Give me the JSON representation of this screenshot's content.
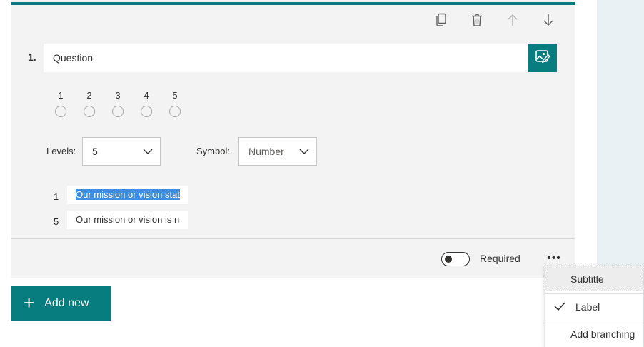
{
  "question": {
    "number": "1.",
    "title": "Question"
  },
  "rating": {
    "options": [
      "1",
      "2",
      "3",
      "4",
      "5"
    ]
  },
  "levels": {
    "label": "Levels:",
    "value": "5"
  },
  "symbol": {
    "label": "Symbol:",
    "value": "Number"
  },
  "level_labels": [
    {
      "num": "1",
      "text": "Our mission or vision stat"
    },
    {
      "num": "5",
      "text": "Our mission or vision is n"
    }
  ],
  "footer": {
    "required_label": "Required",
    "required_on": false,
    "more": "•••"
  },
  "add_new": {
    "plus": "+",
    "label": "Add new"
  },
  "menu": {
    "items": [
      {
        "label": "Subtitle",
        "checked": false,
        "focused": true
      },
      {
        "label": "Label",
        "checked": true,
        "focused": false
      },
      {
        "label": "Add branching",
        "checked": false,
        "focused": false
      }
    ]
  },
  "colors": {
    "accent": "#077d7f",
    "selection": "#3d8ee0",
    "card_bg": "#f3f3f3",
    "side_panel": "#e9f1f4"
  },
  "icons": {
    "toolbar": [
      "copy-icon",
      "delete-icon",
      "arrow-up-icon",
      "arrow-down-icon"
    ],
    "image": "image-edit-icon",
    "check": "check-icon",
    "chevron": "chevron-down-icon"
  }
}
